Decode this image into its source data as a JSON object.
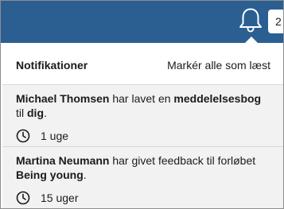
{
  "header": {
    "badge_text": "2",
    "bell_icon": "bell-icon"
  },
  "panel": {
    "title": "Notifikationer",
    "mark_all_label": "Markér alle som læst"
  },
  "notifications": [
    {
      "actor": "Michael Thomsen",
      "text_1": " har lavet en ",
      "object": "meddelelsesbog",
      "text_2": " til ",
      "target": "dig",
      "text_3": ".",
      "time_icon": "clock-icon",
      "time": "1 uge"
    },
    {
      "actor": "Martina Neumann",
      "text_1": " har givet feedback til forløbet ",
      "object": "Being young",
      "text_2": ".",
      "time_icon": "clock-icon",
      "time": "15 uger"
    }
  ],
  "colors": {
    "topbar": "#2b5f91",
    "item_background": "#f2f2f2",
    "text": "#1b1b1b"
  }
}
